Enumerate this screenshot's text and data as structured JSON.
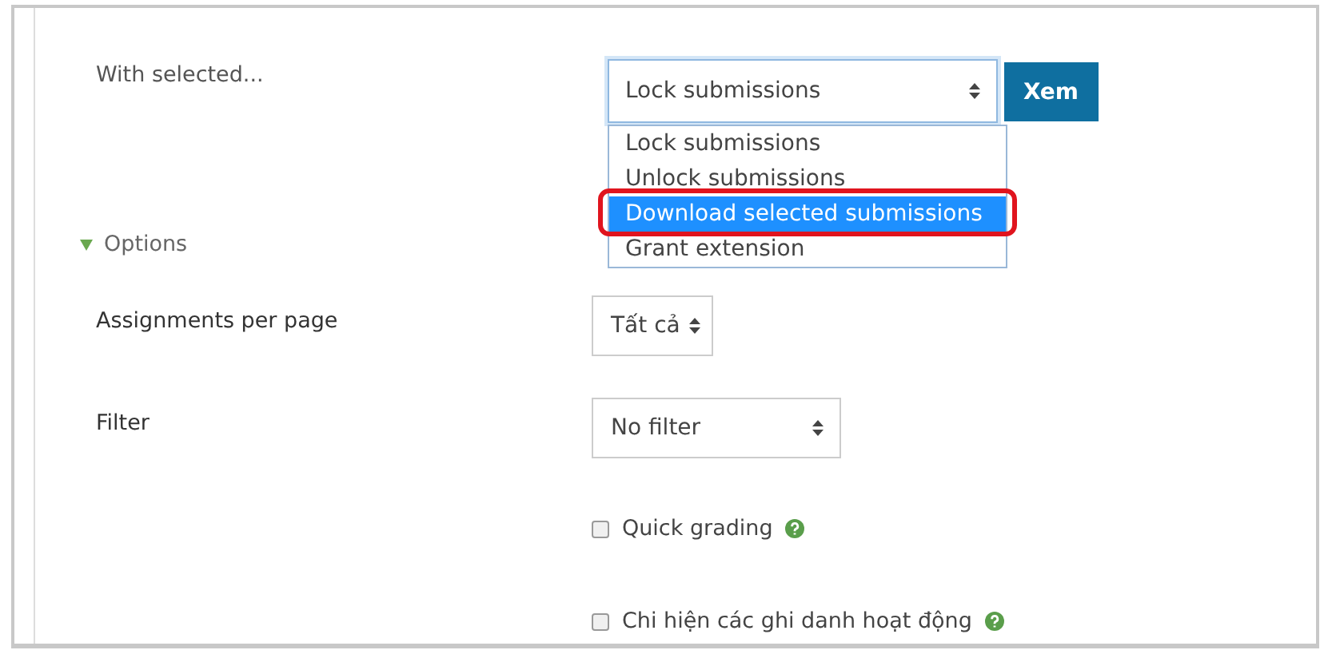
{
  "bulk_action": {
    "label": "With selected...",
    "select": {
      "value": "Lock submissions",
      "expanded": true
    },
    "button": "Xem",
    "options": [
      {
        "label": "Lock submissions",
        "selected": false
      },
      {
        "label": "Unlock submissions",
        "selected": false
      },
      {
        "label": "Download selected submissions",
        "selected": true,
        "highlighted": true
      },
      {
        "label": "Grant extension",
        "selected": false
      }
    ]
  },
  "options_section": {
    "title": "Options",
    "expanded": true
  },
  "fields": [
    {
      "kind": "select",
      "label": "Assignments per page",
      "value": "Tất cả"
    },
    {
      "kind": "select",
      "label": "Filter",
      "value": "No filter"
    }
  ],
  "checkboxes": [
    {
      "label": "Quick grading",
      "checked": false
    },
    {
      "label": "Chi hiện các ghi danh hoạt động",
      "checked": false
    }
  ]
}
